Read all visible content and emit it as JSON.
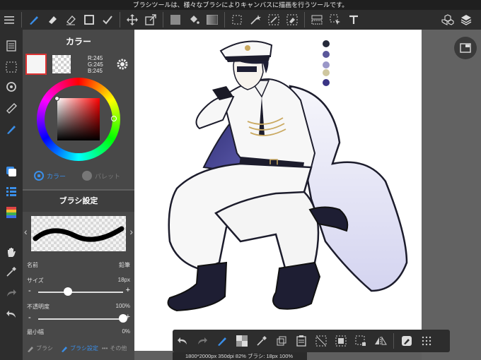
{
  "status_bar": {
    "tip": "ブラシツールは、様々なブラシによりキャンバスに描画を行うツールです。"
  },
  "toolbar": {
    "icons": [
      "menu-icon",
      "brush-icon",
      "eraser-icon",
      "blur-eraser-icon",
      "rect-shape-icon",
      "fill-check-icon",
      "move-icon",
      "transform-icon",
      "fill-color-icon",
      "bucket-icon",
      "gradient-icon",
      "select-icon",
      "magic-wand-icon",
      "select-pen-icon",
      "select-eraser-icon",
      "layer-select-icon",
      "select-arrow-icon",
      "text-tool-icon",
      "material-icon",
      "layers-icon"
    ]
  },
  "color_panel": {
    "title": "カラー",
    "rgb_r": "R:245",
    "rgb_g": "G:245",
    "rgb_b": "B:245",
    "tab_color": "カラー",
    "tab_palette": "パレット",
    "current_color": "#f5f5f5"
  },
  "brush_panel": {
    "title": "ブラシ設定",
    "name_label": "名前",
    "name_value": "鉛筆",
    "size_label": "サイズ",
    "size_value": "18px",
    "size_level": 0.35,
    "opacity_label": "不透明度",
    "opacity_value": "100%",
    "opacity_level": 1.0,
    "min_width_label": "最小幅",
    "min_width_value": "0%",
    "tab_brush": "ブラシ",
    "tab_brush_settings": "ブラシ設定",
    "tab_other": "その他"
  },
  "info_bar": {
    "text": "1800*2000px 350dpi 82% ブラシ: 18px 100%"
  },
  "palette_colors": [
    "#262a3a",
    "#5a579a",
    "#9a97c8",
    "#cfc7a0",
    "#3a3585"
  ],
  "colors": {
    "accent": "#3a8ee8",
    "panel_bg": "#464646",
    "toolbar_bg": "#2d2d2d"
  }
}
